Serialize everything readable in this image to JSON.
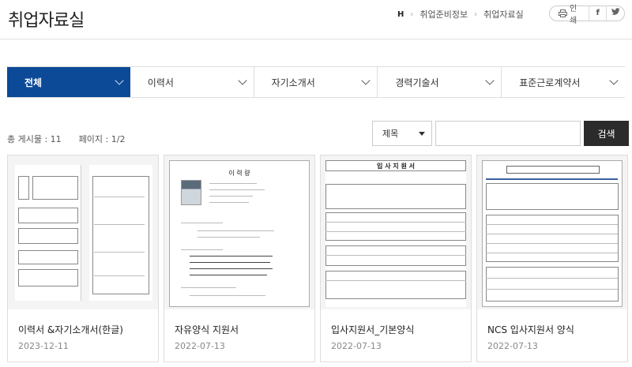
{
  "header": {
    "title": "취업자료실",
    "breadcrumb": [
      "H",
      "취업준비정보",
      "취업자료실"
    ],
    "print_label": "인쇄",
    "sns": [
      "f",
      "twitter"
    ]
  },
  "tabs": [
    {
      "label": "전체",
      "active": true
    },
    {
      "label": "이력서",
      "active": false
    },
    {
      "label": "자기소개서",
      "active": false
    },
    {
      "label": "경력기술서",
      "active": false
    },
    {
      "label": "표준근로계약서",
      "active": false
    }
  ],
  "list_info": {
    "total": "총 게시물 : 11",
    "page": "페이지 : 1/2"
  },
  "search": {
    "select_value": "제목",
    "input_value": "",
    "button": "검색"
  },
  "cards": [
    {
      "title": "이력서 &자기소개서(한글)",
      "date": "2023-12-11"
    },
    {
      "title": "자유양식 지원서",
      "date": "2022-07-13",
      "doc_heading": "이 력 량"
    },
    {
      "title": "입사지원서_기본양식",
      "date": "2022-07-13",
      "doc_heading": "입 사 지 원 서"
    },
    {
      "title": "NCS 입사지원서 양식",
      "date": "2022-07-13"
    }
  ],
  "colors": {
    "active_tab": "#0c4a97",
    "search_button": "#2b2b2b"
  }
}
